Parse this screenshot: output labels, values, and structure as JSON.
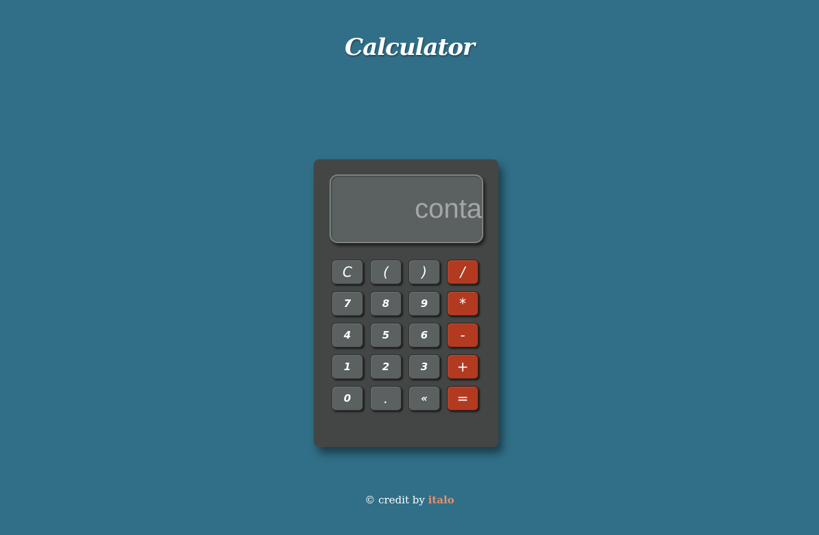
{
  "header": {
    "title": "Calculator"
  },
  "display": {
    "placeholder": "conta",
    "value": ""
  },
  "keypad": {
    "rows": [
      [
        "C",
        "(",
        ")",
        "/"
      ],
      [
        "7",
        "8",
        "9",
        "*"
      ],
      [
        "4",
        "5",
        "6",
        "-"
      ],
      [
        "1",
        "2",
        "3",
        "+"
      ],
      [
        "0",
        ".",
        "«",
        "="
      ]
    ]
  },
  "footer": {
    "credit_prefix": "© credit by",
    "author": "italo"
  },
  "colors": {
    "background": "#306f87",
    "calculator_body": "#444646",
    "display": "#5b6061",
    "key": "#5b6061",
    "operator_key": "#b23a20",
    "author_link": "#e8906a"
  }
}
